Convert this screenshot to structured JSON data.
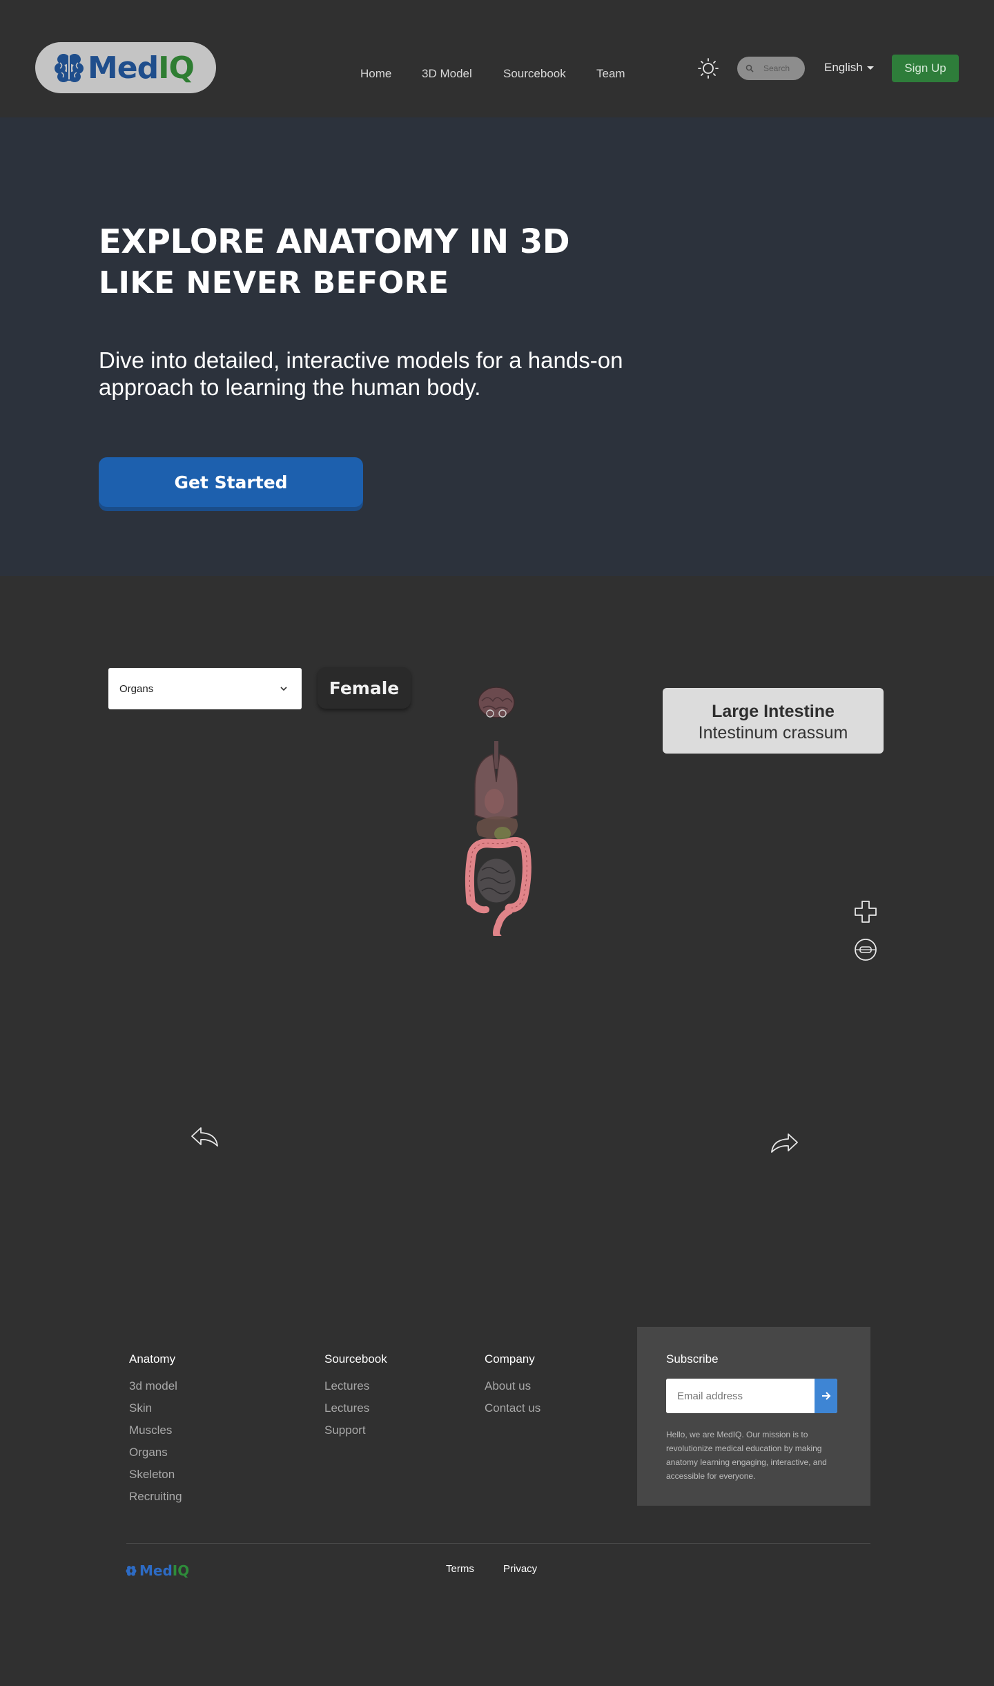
{
  "brand": {
    "name_part1": "Med",
    "name_part2": "IQ"
  },
  "nav": {
    "links": [
      "Home",
      "3D Model",
      "Sourcebook",
      "Team"
    ],
    "search_placeholder": "Search",
    "language": "English",
    "signup_label": "Sign Up"
  },
  "hero": {
    "title_line1": "EXPLORE ANATOMY IN 3D",
    "title_line2": "LIKE NEVER BEFORE",
    "description": "Dive into detailed, interactive models for a hands-on approach to learning the human body.",
    "cta_label": "Get Started"
  },
  "viewer": {
    "system_select": "Organs",
    "sex_label": "Female",
    "selected_organ": {
      "english": "Large Intestine",
      "latin": "Intestinum crassum"
    },
    "icons": [
      "zoom-plus-icon",
      "view-reset-icon",
      "rotate-left-icon",
      "rotate-right-icon"
    ]
  },
  "footer": {
    "anatomy": {
      "title": "Anatomy",
      "links": [
        "3d model",
        "Skin",
        "Muscles",
        "Organs",
        "Skeleton",
        "Recruiting"
      ]
    },
    "sourcebook": {
      "title": "Sourcebook",
      "links": [
        "Lectures",
        "Lectures",
        "Support"
      ]
    },
    "company": {
      "title": "Company",
      "links": [
        "About us",
        "Contact us"
      ]
    },
    "subscribe": {
      "title": "Subscribe",
      "email_placeholder": "Email address",
      "text": "Hello, we are MedIQ. Our mission is to revolutionize medical education by making anatomy learning engaging, interactive, and accessible for everyone."
    },
    "legal": [
      "Terms",
      "Privacy"
    ]
  },
  "colors": {
    "page_bg": "#303030",
    "hero_bg": "#2c323c",
    "brand_blue": "#1f4e8c",
    "brand_green": "#2e7d32",
    "cta_blue": "#1d60ae",
    "signup_green": "#2e7d3a",
    "subscribe_button": "#3e85d4"
  }
}
